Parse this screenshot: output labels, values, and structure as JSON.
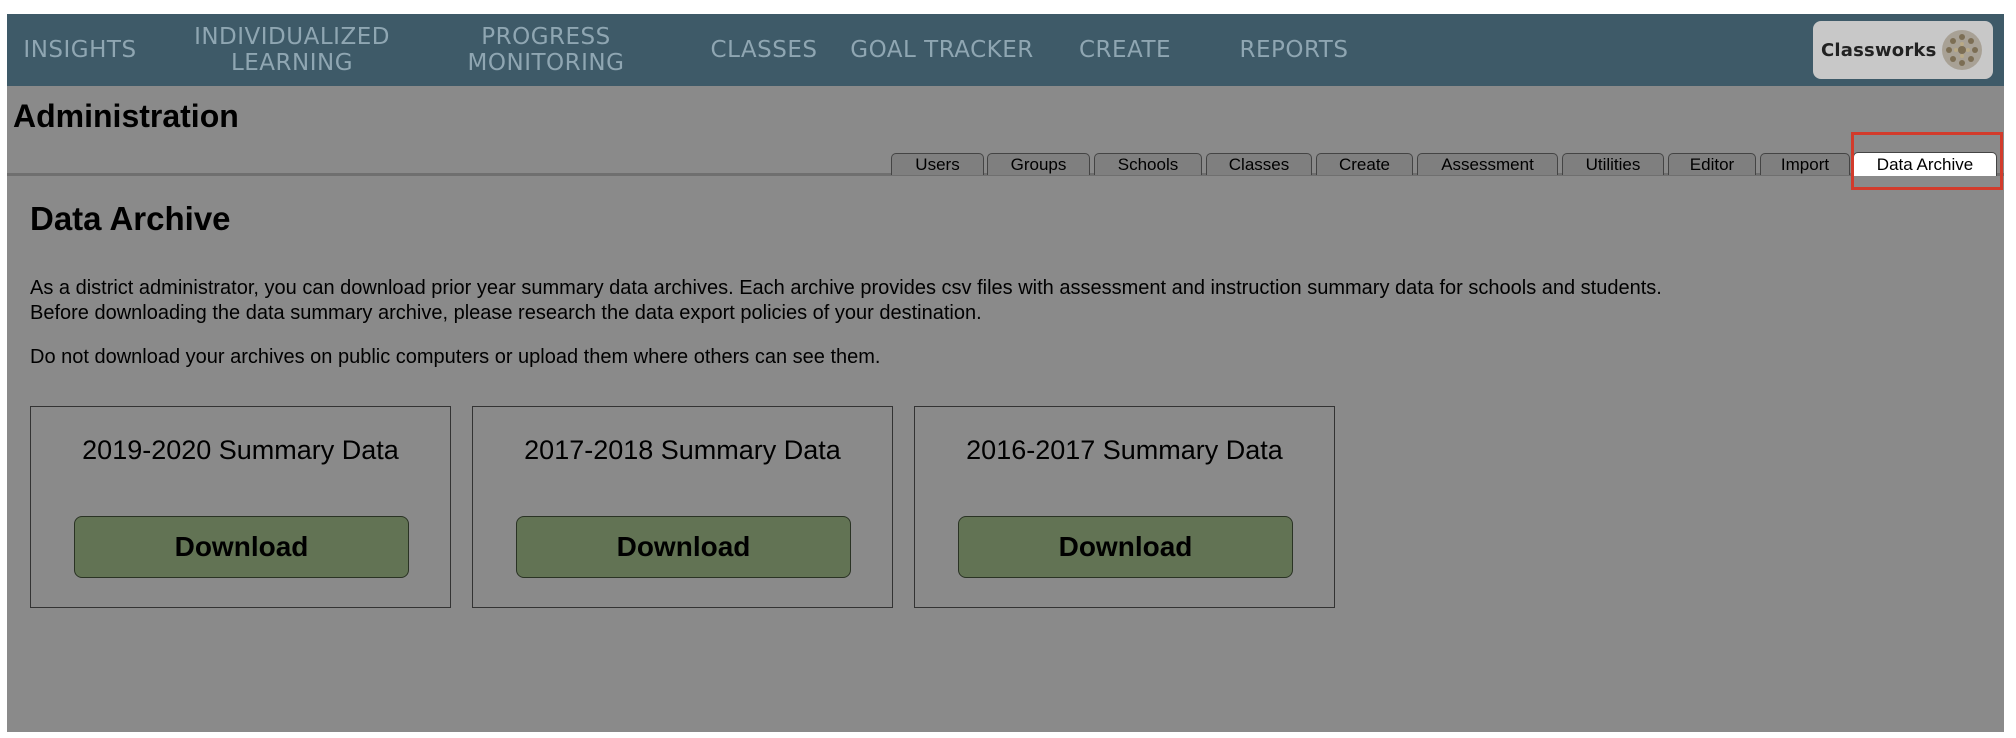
{
  "nav": {
    "items": [
      {
        "label": "INSIGHTS"
      },
      {
        "label": "INDIVIDUALIZED LEARNING"
      },
      {
        "label": "PROGRESS MONITORING"
      },
      {
        "label": "CLASSES"
      },
      {
        "label": "GOAL TRACKER"
      },
      {
        "label": "CREATE"
      },
      {
        "label": "REPORTS"
      }
    ],
    "brand": "Classworks",
    "color": "#3e5a68"
  },
  "page": {
    "title": "Administration"
  },
  "tabs": [
    {
      "label": "Users"
    },
    {
      "label": "Groups"
    },
    {
      "label": "Schools"
    },
    {
      "label": "Classes"
    },
    {
      "label": "Create"
    },
    {
      "label": "Assessment"
    },
    {
      "label": "Utilities"
    },
    {
      "label": "Editor"
    },
    {
      "label": "Import"
    },
    {
      "label": "Data Archive",
      "active": true
    }
  ],
  "content": {
    "title": "Data Archive",
    "paragraph1_line1": "As a district administrator, you can download prior year summary data archives. Each archive provides csv files with assessment and instruction summary data for schools and students.",
    "paragraph1_line2": "Before downloading the data summary archive, please research the data export policies of your destination.",
    "paragraph2": "Do not download your archives on public computers or upload them where others can see them."
  },
  "archives": [
    {
      "title": "2019-2020 Summary Data",
      "button": "Download"
    },
    {
      "title": "2017-2018 Summary Data",
      "button": "Download"
    },
    {
      "title": "2016-2017 Summary Data",
      "button": "Download"
    }
  ],
  "colors": {
    "download_button": "#627354",
    "highlight": "#d23b2b"
  }
}
